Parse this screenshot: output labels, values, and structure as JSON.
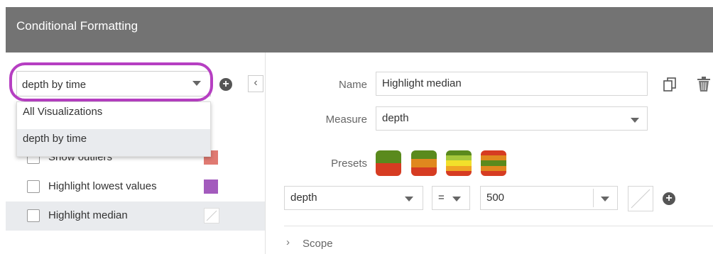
{
  "header": {
    "title": "Conditional Formatting"
  },
  "left": {
    "combo_value": "depth by time",
    "dropdown_options": [
      "All Visualizations",
      "depth by time"
    ],
    "rules": [
      {
        "label": "Show outliers",
        "color": "#e07a72",
        "checked": false
      },
      {
        "label": "Highlight lowest values",
        "color": "#a35bbd",
        "checked": false
      },
      {
        "label": "Highlight median",
        "color": "none",
        "checked": false
      }
    ]
  },
  "right": {
    "name_label": "Name",
    "name_value": "Highlight median",
    "measure_label": "Measure",
    "measure_value": "depth",
    "presets_label": "Presets",
    "condition": {
      "field": "depth",
      "operator": "=",
      "value": "500"
    },
    "scope_label": "Scope"
  },
  "colors": {
    "header_bg": "#737373",
    "accent_oval": "#b63fc2",
    "selected_row": "#e9ebee"
  }
}
